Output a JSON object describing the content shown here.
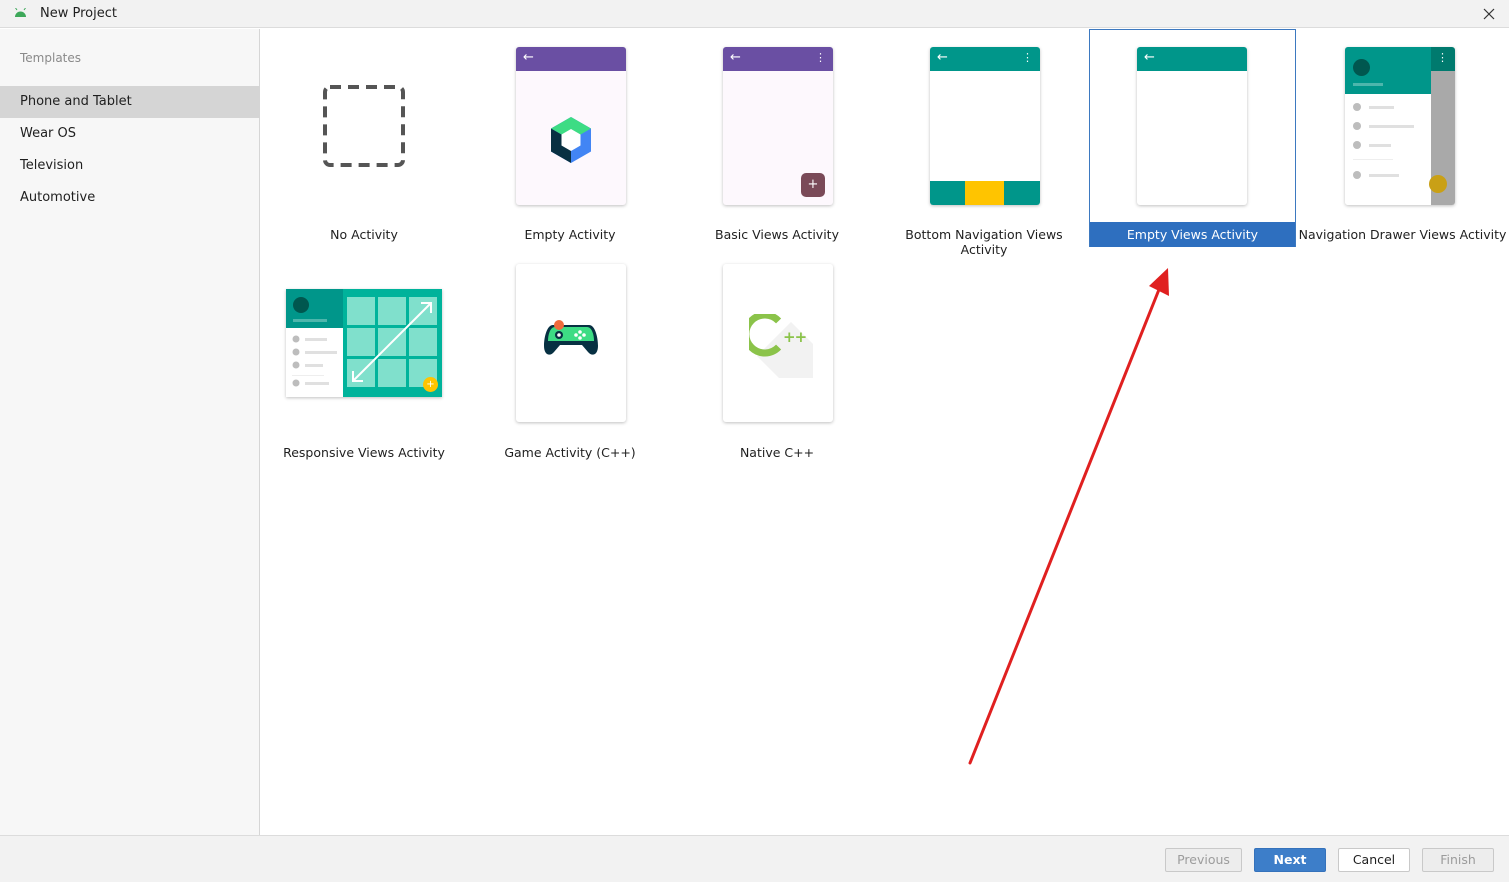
{
  "window": {
    "title": "New Project"
  },
  "sidebar": {
    "section_title": "Templates",
    "items": [
      {
        "label": "Phone and Tablet",
        "selected": true
      },
      {
        "label": "Wear OS"
      },
      {
        "label": "Television"
      },
      {
        "label": "Automotive"
      }
    ]
  },
  "templates": [
    {
      "label": "No Activity"
    },
    {
      "label": "Empty Activity"
    },
    {
      "label": "Basic Views Activity"
    },
    {
      "label": "Bottom Navigation Views Activity"
    },
    {
      "label": "Empty Views Activity",
      "selected": true
    },
    {
      "label": "Navigation Drawer Views Activity"
    },
    {
      "label": "Responsive Views Activity"
    },
    {
      "label": "Game Activity (C++)"
    },
    {
      "label": "Native C++"
    }
  ],
  "icons": {
    "back": "←",
    "more": "⋮",
    "plus": "+",
    "cpp_mark": "++"
  },
  "footer": {
    "previous": "Previous",
    "next": "Next",
    "cancel": "Cancel",
    "finish": "Finish"
  },
  "colors": {
    "selection": "#2e6fbf",
    "purple_bar": "#6a4fa3",
    "teal_bar": "#00968a",
    "accent_yellow": "#ffc400",
    "annotation_arrow": "#e02020"
  }
}
